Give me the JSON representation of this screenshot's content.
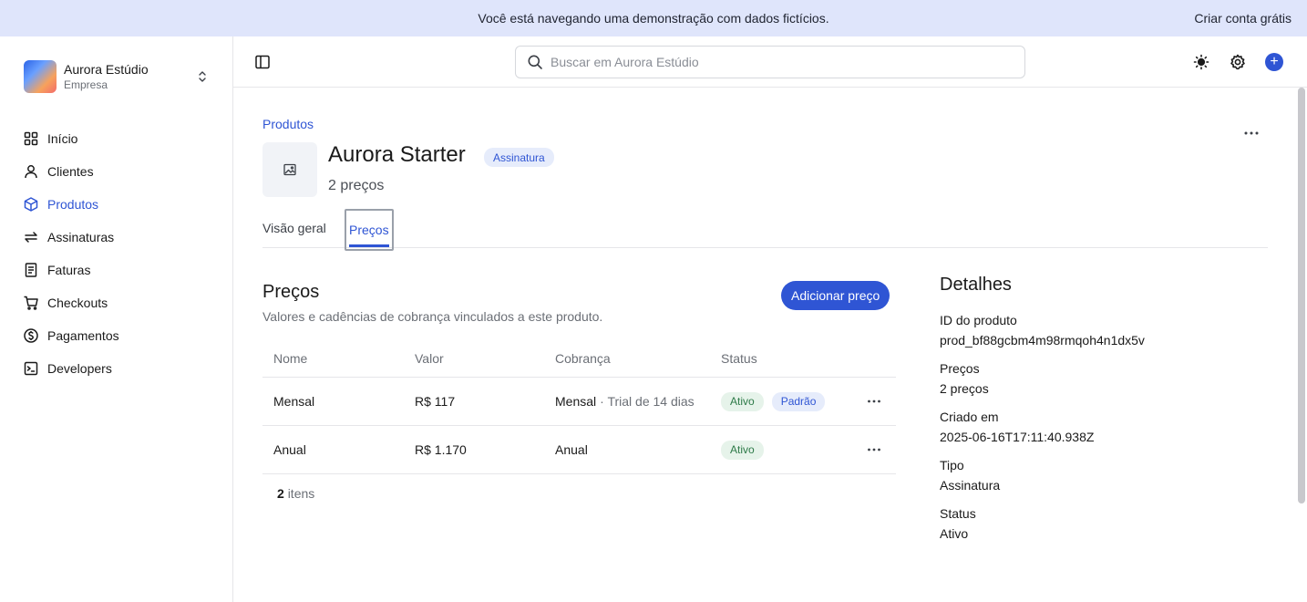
{
  "banner": {
    "message": "Você está navegando uma demonstração com dados fictícios.",
    "cta": "Criar conta grátis"
  },
  "org": {
    "name": "Aurora Estúdio",
    "type": "Empresa"
  },
  "nav": [
    {
      "label": "Início",
      "icon": "home-grid-icon"
    },
    {
      "label": "Clientes",
      "icon": "user-icon"
    },
    {
      "label": "Produtos",
      "icon": "box-icon",
      "active": true
    },
    {
      "label": "Assinaturas",
      "icon": "refresh-icon"
    },
    {
      "label": "Faturas",
      "icon": "invoice-icon"
    },
    {
      "label": "Checkouts",
      "icon": "cart-icon"
    },
    {
      "label": "Pagamentos",
      "icon": "dollar-icon"
    },
    {
      "label": "Developers",
      "icon": "terminal-icon"
    }
  ],
  "search": {
    "placeholder": "Buscar em Aurora Estúdio",
    "value": ""
  },
  "breadcrumb": "Produtos",
  "product": {
    "name": "Aurora Starter",
    "type_badge": "Assinatura",
    "subtitle": "2 preços"
  },
  "tabs": {
    "overview": "Visão geral",
    "prices": "Preços"
  },
  "prices_section": {
    "title": "Preços",
    "description": "Valores e cadências de cobrança vinculados a este produto.",
    "add_button": "Adicionar preço",
    "columns": {
      "name": "Nome",
      "value": "Valor",
      "billing": "Cobrança",
      "status": "Status"
    },
    "rows": [
      {
        "name": "Mensal",
        "value": "R$ 117",
        "billing": "Mensal",
        "billing_extra": "· Trial de 14 dias",
        "status": "Ativo",
        "default_badge": "Padrão"
      },
      {
        "name": "Anual",
        "value": "R$ 1.170",
        "billing": "Anual",
        "billing_extra": "",
        "status": "Ativo",
        "default_badge": ""
      }
    ],
    "count": {
      "number": "2",
      "label": "itens"
    }
  },
  "details": {
    "title": "Detalhes",
    "items": [
      {
        "label": "ID do produto",
        "value": "prod_bf88gcbm4m98rmqoh4n1dx5v"
      },
      {
        "label": "Preços",
        "value": "2 preços"
      },
      {
        "label": "Criado em",
        "value": "2025-06-16T17:11:40.938Z"
      },
      {
        "label": "Tipo",
        "value": "Assinatura"
      },
      {
        "label": "Status",
        "value": "Ativo"
      }
    ]
  },
  "colors": {
    "accent": "#2f55d4",
    "banner_bg": "#dfe5fb",
    "status_green_bg": "#e6f3ea",
    "status_green_text": "#2d7a48"
  }
}
